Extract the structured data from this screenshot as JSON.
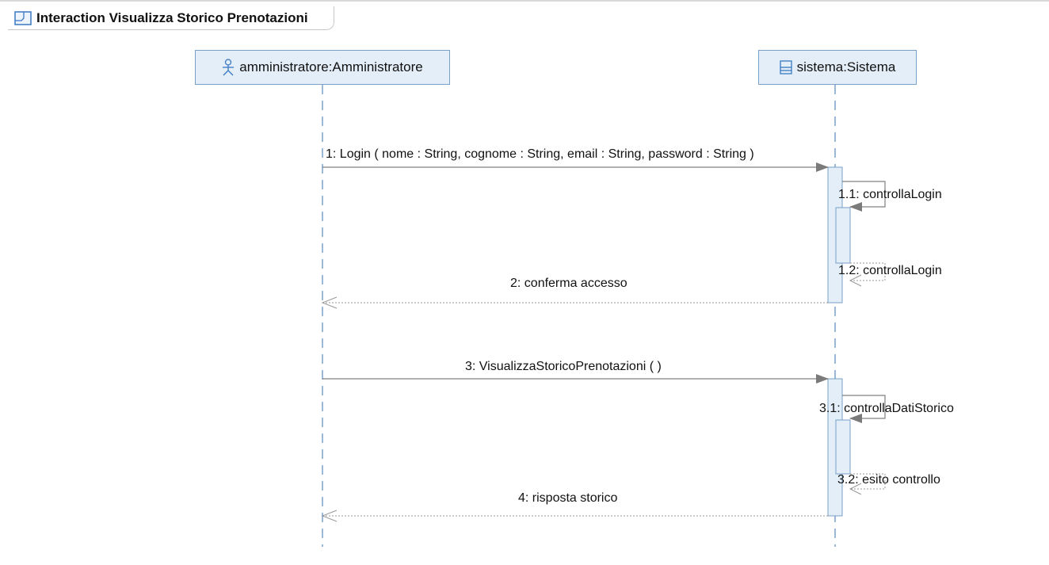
{
  "frame": {
    "title": "Interaction Visualizza Storico Prenotazioni",
    "icon": "interaction-frame-icon"
  },
  "lifelines": {
    "admin": {
      "label": "amministratore:Amministratore",
      "icon": "actor-icon"
    },
    "system": {
      "label": "sistema:Sistema",
      "icon": "class-icon"
    }
  },
  "messages": {
    "m1": "1: Login ( nome : String, cognome : String, email : String, password : String )",
    "m1_1": "1.1: controllaLogin",
    "m1_2": "1.2: controllaLogin",
    "m2": "2: conferma accesso",
    "m3": "3: VisualizzaStoricoPrenotazioni ( )",
    "m3_1": "3.1: controllaDatiStorico",
    "m3_2": "3.2: esito controllo",
    "m4": "4: risposta storico"
  },
  "colors": {
    "lifeline": "#7aa0c8",
    "head_fill": "#e3eef8",
    "activation_fill": "#e3eef8",
    "message_line": "#808080"
  }
}
